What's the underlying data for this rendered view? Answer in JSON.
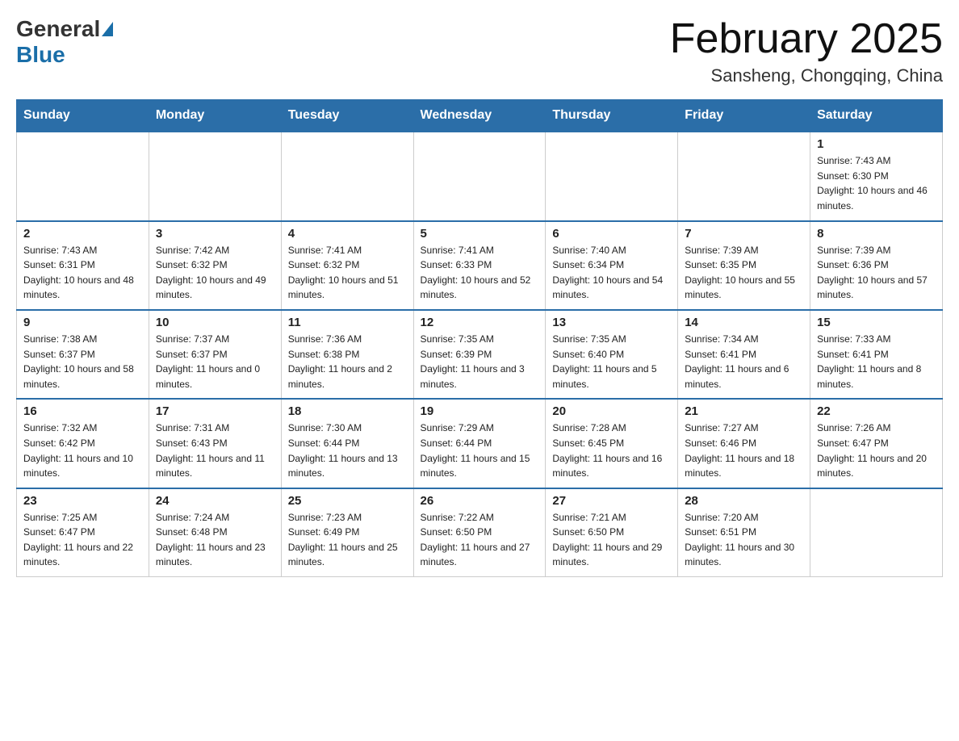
{
  "header": {
    "logo": {
      "general": "General",
      "blue": "Blue"
    },
    "title": "February 2025",
    "subtitle": "Sansheng, Chongqing, China"
  },
  "weekdays": [
    "Sunday",
    "Monday",
    "Tuesday",
    "Wednesday",
    "Thursday",
    "Friday",
    "Saturday"
  ],
  "weeks": [
    [
      null,
      null,
      null,
      null,
      null,
      null,
      {
        "day": "1",
        "sunrise": "Sunrise: 7:43 AM",
        "sunset": "Sunset: 6:30 PM",
        "daylight": "Daylight: 10 hours and 46 minutes."
      }
    ],
    [
      {
        "day": "2",
        "sunrise": "Sunrise: 7:43 AM",
        "sunset": "Sunset: 6:31 PM",
        "daylight": "Daylight: 10 hours and 48 minutes."
      },
      {
        "day": "3",
        "sunrise": "Sunrise: 7:42 AM",
        "sunset": "Sunset: 6:32 PM",
        "daylight": "Daylight: 10 hours and 49 minutes."
      },
      {
        "day": "4",
        "sunrise": "Sunrise: 7:41 AM",
        "sunset": "Sunset: 6:32 PM",
        "daylight": "Daylight: 10 hours and 51 minutes."
      },
      {
        "day": "5",
        "sunrise": "Sunrise: 7:41 AM",
        "sunset": "Sunset: 6:33 PM",
        "daylight": "Daylight: 10 hours and 52 minutes."
      },
      {
        "day": "6",
        "sunrise": "Sunrise: 7:40 AM",
        "sunset": "Sunset: 6:34 PM",
        "daylight": "Daylight: 10 hours and 54 minutes."
      },
      {
        "day": "7",
        "sunrise": "Sunrise: 7:39 AM",
        "sunset": "Sunset: 6:35 PM",
        "daylight": "Daylight: 10 hours and 55 minutes."
      },
      {
        "day": "8",
        "sunrise": "Sunrise: 7:39 AM",
        "sunset": "Sunset: 6:36 PM",
        "daylight": "Daylight: 10 hours and 57 minutes."
      }
    ],
    [
      {
        "day": "9",
        "sunrise": "Sunrise: 7:38 AM",
        "sunset": "Sunset: 6:37 PM",
        "daylight": "Daylight: 10 hours and 58 minutes."
      },
      {
        "day": "10",
        "sunrise": "Sunrise: 7:37 AM",
        "sunset": "Sunset: 6:37 PM",
        "daylight": "Daylight: 11 hours and 0 minutes."
      },
      {
        "day": "11",
        "sunrise": "Sunrise: 7:36 AM",
        "sunset": "Sunset: 6:38 PM",
        "daylight": "Daylight: 11 hours and 2 minutes."
      },
      {
        "day": "12",
        "sunrise": "Sunrise: 7:35 AM",
        "sunset": "Sunset: 6:39 PM",
        "daylight": "Daylight: 11 hours and 3 minutes."
      },
      {
        "day": "13",
        "sunrise": "Sunrise: 7:35 AM",
        "sunset": "Sunset: 6:40 PM",
        "daylight": "Daylight: 11 hours and 5 minutes."
      },
      {
        "day": "14",
        "sunrise": "Sunrise: 7:34 AM",
        "sunset": "Sunset: 6:41 PM",
        "daylight": "Daylight: 11 hours and 6 minutes."
      },
      {
        "day": "15",
        "sunrise": "Sunrise: 7:33 AM",
        "sunset": "Sunset: 6:41 PM",
        "daylight": "Daylight: 11 hours and 8 minutes."
      }
    ],
    [
      {
        "day": "16",
        "sunrise": "Sunrise: 7:32 AM",
        "sunset": "Sunset: 6:42 PM",
        "daylight": "Daylight: 11 hours and 10 minutes."
      },
      {
        "day": "17",
        "sunrise": "Sunrise: 7:31 AM",
        "sunset": "Sunset: 6:43 PM",
        "daylight": "Daylight: 11 hours and 11 minutes."
      },
      {
        "day": "18",
        "sunrise": "Sunrise: 7:30 AM",
        "sunset": "Sunset: 6:44 PM",
        "daylight": "Daylight: 11 hours and 13 minutes."
      },
      {
        "day": "19",
        "sunrise": "Sunrise: 7:29 AM",
        "sunset": "Sunset: 6:44 PM",
        "daylight": "Daylight: 11 hours and 15 minutes."
      },
      {
        "day": "20",
        "sunrise": "Sunrise: 7:28 AM",
        "sunset": "Sunset: 6:45 PM",
        "daylight": "Daylight: 11 hours and 16 minutes."
      },
      {
        "day": "21",
        "sunrise": "Sunrise: 7:27 AM",
        "sunset": "Sunset: 6:46 PM",
        "daylight": "Daylight: 11 hours and 18 minutes."
      },
      {
        "day": "22",
        "sunrise": "Sunrise: 7:26 AM",
        "sunset": "Sunset: 6:47 PM",
        "daylight": "Daylight: 11 hours and 20 minutes."
      }
    ],
    [
      {
        "day": "23",
        "sunrise": "Sunrise: 7:25 AM",
        "sunset": "Sunset: 6:47 PM",
        "daylight": "Daylight: 11 hours and 22 minutes."
      },
      {
        "day": "24",
        "sunrise": "Sunrise: 7:24 AM",
        "sunset": "Sunset: 6:48 PM",
        "daylight": "Daylight: 11 hours and 23 minutes."
      },
      {
        "day": "25",
        "sunrise": "Sunrise: 7:23 AM",
        "sunset": "Sunset: 6:49 PM",
        "daylight": "Daylight: 11 hours and 25 minutes."
      },
      {
        "day": "26",
        "sunrise": "Sunrise: 7:22 AM",
        "sunset": "Sunset: 6:50 PM",
        "daylight": "Daylight: 11 hours and 27 minutes."
      },
      {
        "day": "27",
        "sunrise": "Sunrise: 7:21 AM",
        "sunset": "Sunset: 6:50 PM",
        "daylight": "Daylight: 11 hours and 29 minutes."
      },
      {
        "day": "28",
        "sunrise": "Sunrise: 7:20 AM",
        "sunset": "Sunset: 6:51 PM",
        "daylight": "Daylight: 11 hours and 30 minutes."
      },
      null
    ]
  ]
}
